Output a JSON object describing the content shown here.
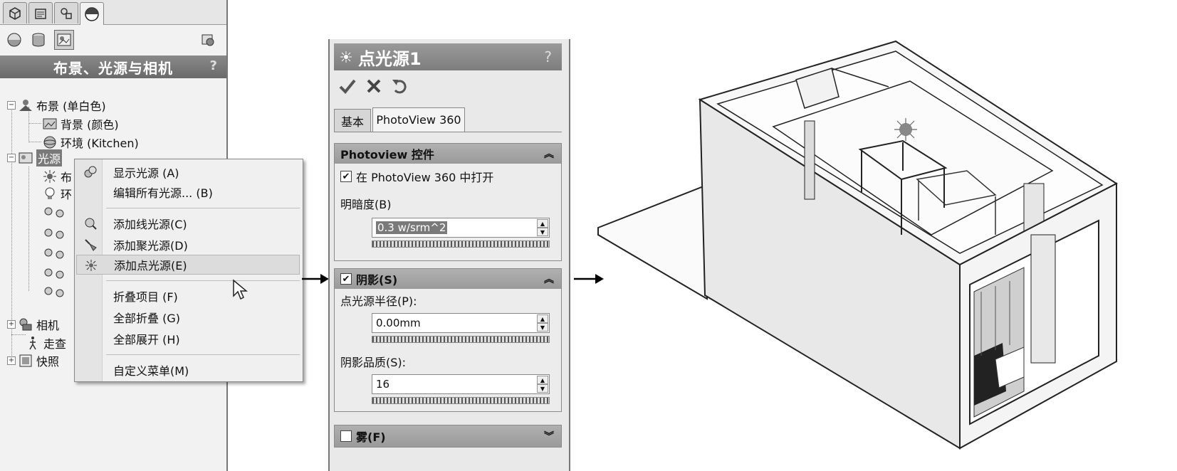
{
  "left_panel": {
    "tabs": [
      "part-icon",
      "property-icon",
      "config-icon",
      "render-icon"
    ],
    "toolbar_icons": [
      "appearance-icon",
      "decal-icon",
      "scene-icon",
      "options-icon"
    ],
    "header": {
      "title": "布景、光源与相机",
      "help": "?"
    },
    "tree": {
      "scene": "布景 (单白色)",
      "background": "背景 (颜色)",
      "environment": "环境 (Kitchen)",
      "lights_partial": "光源",
      "light_row1_partial": "布",
      "light_row2_partial": "环",
      "camera_partial": "相机",
      "walkthrough_partial": "走查",
      "snapshot_partial": "快照"
    }
  },
  "context_menu": {
    "items": [
      {
        "label": "显示光源 (A)",
        "icon": "show-lights-icon"
      },
      {
        "label": "编辑所有光源... (B)",
        "icon": ""
      },
      {
        "label": "添加线光源(C)",
        "icon": "directional-light-icon"
      },
      {
        "label": "添加聚光源(D)",
        "icon": "spot-light-icon"
      },
      {
        "label": "添加点光源(E)",
        "icon": "point-light-icon"
      },
      {
        "label": "折叠项目 (F)",
        "icon": ""
      },
      {
        "label": "全部折叠 (G)",
        "icon": ""
      },
      {
        "label": "全部展开 (H)",
        "icon": ""
      },
      {
        "label": "自定义菜单(M)",
        "icon": ""
      }
    ],
    "highlighted_index": 4
  },
  "property_manager": {
    "title": "点光源1",
    "help": "?",
    "actions": [
      "ok-check-icon",
      "cancel-x-icon",
      "undo-icon"
    ],
    "tabs": [
      "基本",
      "PhotoView 360"
    ],
    "active_tab": 1,
    "photoview_group": {
      "title": "Photoview 控件",
      "checkbox_label": "在 PhotoView 360 中打开",
      "checked": true,
      "brightness_label": "明暗度(B)",
      "brightness_value": "0.3 w/srm^2"
    },
    "shadow_group": {
      "title": "阴影(S)",
      "checked": true,
      "radius_label": "点光源半径(P):",
      "radius_value": "0.00mm",
      "quality_label": "阴影品质(S):",
      "quality_value": "16"
    },
    "fog_group": {
      "title": "雾(F)",
      "checked": false
    }
  },
  "colors": {
    "panel_bg": "#e9e9e9",
    "header_gray": "#7d7d7d",
    "menu_highlight": "#dcdcdc"
  }
}
